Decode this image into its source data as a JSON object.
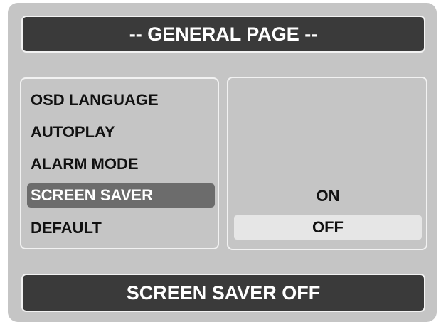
{
  "title": "-- GENERAL PAGE --",
  "menu": {
    "items": [
      {
        "label": "OSD LANGUAGE",
        "selected": false
      },
      {
        "label": "AUTOPLAY",
        "selected": false
      },
      {
        "label": "ALARM MODE",
        "selected": false
      },
      {
        "label": "SCREEN SAVER",
        "selected": true
      },
      {
        "label": "DEFAULT",
        "selected": false
      }
    ]
  },
  "values": {
    "options": [
      {
        "label": "ON",
        "highlighted": false
      },
      {
        "label": "OFF",
        "highlighted": true
      }
    ]
  },
  "status": "SCREEN SAVER OFF",
  "colors": {
    "panel_background": "#c5c5c5",
    "bar_background": "#3a3a3a",
    "selected_item": "#6c6c6c",
    "highlighted_option": "#e6e6e6"
  }
}
